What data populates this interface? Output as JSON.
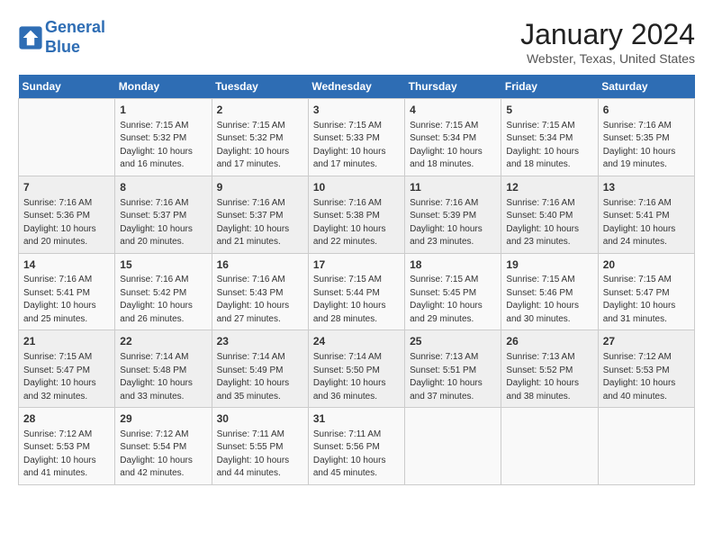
{
  "header": {
    "logo_line1": "General",
    "logo_line2": "Blue",
    "month": "January 2024",
    "location": "Webster, Texas, United States"
  },
  "weekdays": [
    "Sunday",
    "Monday",
    "Tuesday",
    "Wednesday",
    "Thursday",
    "Friday",
    "Saturday"
  ],
  "weeks": [
    [
      {
        "day": "",
        "info": ""
      },
      {
        "day": "1",
        "info": "Sunrise: 7:15 AM\nSunset: 5:32 PM\nDaylight: 10 hours\nand 16 minutes."
      },
      {
        "day": "2",
        "info": "Sunrise: 7:15 AM\nSunset: 5:32 PM\nDaylight: 10 hours\nand 17 minutes."
      },
      {
        "day": "3",
        "info": "Sunrise: 7:15 AM\nSunset: 5:33 PM\nDaylight: 10 hours\nand 17 minutes."
      },
      {
        "day": "4",
        "info": "Sunrise: 7:15 AM\nSunset: 5:34 PM\nDaylight: 10 hours\nand 18 minutes."
      },
      {
        "day": "5",
        "info": "Sunrise: 7:15 AM\nSunset: 5:34 PM\nDaylight: 10 hours\nand 18 minutes."
      },
      {
        "day": "6",
        "info": "Sunrise: 7:16 AM\nSunset: 5:35 PM\nDaylight: 10 hours\nand 19 minutes."
      }
    ],
    [
      {
        "day": "7",
        "info": "Sunrise: 7:16 AM\nSunset: 5:36 PM\nDaylight: 10 hours\nand 20 minutes."
      },
      {
        "day": "8",
        "info": "Sunrise: 7:16 AM\nSunset: 5:37 PM\nDaylight: 10 hours\nand 20 minutes."
      },
      {
        "day": "9",
        "info": "Sunrise: 7:16 AM\nSunset: 5:37 PM\nDaylight: 10 hours\nand 21 minutes."
      },
      {
        "day": "10",
        "info": "Sunrise: 7:16 AM\nSunset: 5:38 PM\nDaylight: 10 hours\nand 22 minutes."
      },
      {
        "day": "11",
        "info": "Sunrise: 7:16 AM\nSunset: 5:39 PM\nDaylight: 10 hours\nand 23 minutes."
      },
      {
        "day": "12",
        "info": "Sunrise: 7:16 AM\nSunset: 5:40 PM\nDaylight: 10 hours\nand 23 minutes."
      },
      {
        "day": "13",
        "info": "Sunrise: 7:16 AM\nSunset: 5:41 PM\nDaylight: 10 hours\nand 24 minutes."
      }
    ],
    [
      {
        "day": "14",
        "info": "Sunrise: 7:16 AM\nSunset: 5:41 PM\nDaylight: 10 hours\nand 25 minutes."
      },
      {
        "day": "15",
        "info": "Sunrise: 7:16 AM\nSunset: 5:42 PM\nDaylight: 10 hours\nand 26 minutes."
      },
      {
        "day": "16",
        "info": "Sunrise: 7:16 AM\nSunset: 5:43 PM\nDaylight: 10 hours\nand 27 minutes."
      },
      {
        "day": "17",
        "info": "Sunrise: 7:15 AM\nSunset: 5:44 PM\nDaylight: 10 hours\nand 28 minutes."
      },
      {
        "day": "18",
        "info": "Sunrise: 7:15 AM\nSunset: 5:45 PM\nDaylight: 10 hours\nand 29 minutes."
      },
      {
        "day": "19",
        "info": "Sunrise: 7:15 AM\nSunset: 5:46 PM\nDaylight: 10 hours\nand 30 minutes."
      },
      {
        "day": "20",
        "info": "Sunrise: 7:15 AM\nSunset: 5:47 PM\nDaylight: 10 hours\nand 31 minutes."
      }
    ],
    [
      {
        "day": "21",
        "info": "Sunrise: 7:15 AM\nSunset: 5:47 PM\nDaylight: 10 hours\nand 32 minutes."
      },
      {
        "day": "22",
        "info": "Sunrise: 7:14 AM\nSunset: 5:48 PM\nDaylight: 10 hours\nand 33 minutes."
      },
      {
        "day": "23",
        "info": "Sunrise: 7:14 AM\nSunset: 5:49 PM\nDaylight: 10 hours\nand 35 minutes."
      },
      {
        "day": "24",
        "info": "Sunrise: 7:14 AM\nSunset: 5:50 PM\nDaylight: 10 hours\nand 36 minutes."
      },
      {
        "day": "25",
        "info": "Sunrise: 7:13 AM\nSunset: 5:51 PM\nDaylight: 10 hours\nand 37 minutes."
      },
      {
        "day": "26",
        "info": "Sunrise: 7:13 AM\nSunset: 5:52 PM\nDaylight: 10 hours\nand 38 minutes."
      },
      {
        "day": "27",
        "info": "Sunrise: 7:12 AM\nSunset: 5:53 PM\nDaylight: 10 hours\nand 40 minutes."
      }
    ],
    [
      {
        "day": "28",
        "info": "Sunrise: 7:12 AM\nSunset: 5:53 PM\nDaylight: 10 hours\nand 41 minutes."
      },
      {
        "day": "29",
        "info": "Sunrise: 7:12 AM\nSunset: 5:54 PM\nDaylight: 10 hours\nand 42 minutes."
      },
      {
        "day": "30",
        "info": "Sunrise: 7:11 AM\nSunset: 5:55 PM\nDaylight: 10 hours\nand 44 minutes."
      },
      {
        "day": "31",
        "info": "Sunrise: 7:11 AM\nSunset: 5:56 PM\nDaylight: 10 hours\nand 45 minutes."
      },
      {
        "day": "",
        "info": ""
      },
      {
        "day": "",
        "info": ""
      },
      {
        "day": "",
        "info": ""
      }
    ]
  ]
}
